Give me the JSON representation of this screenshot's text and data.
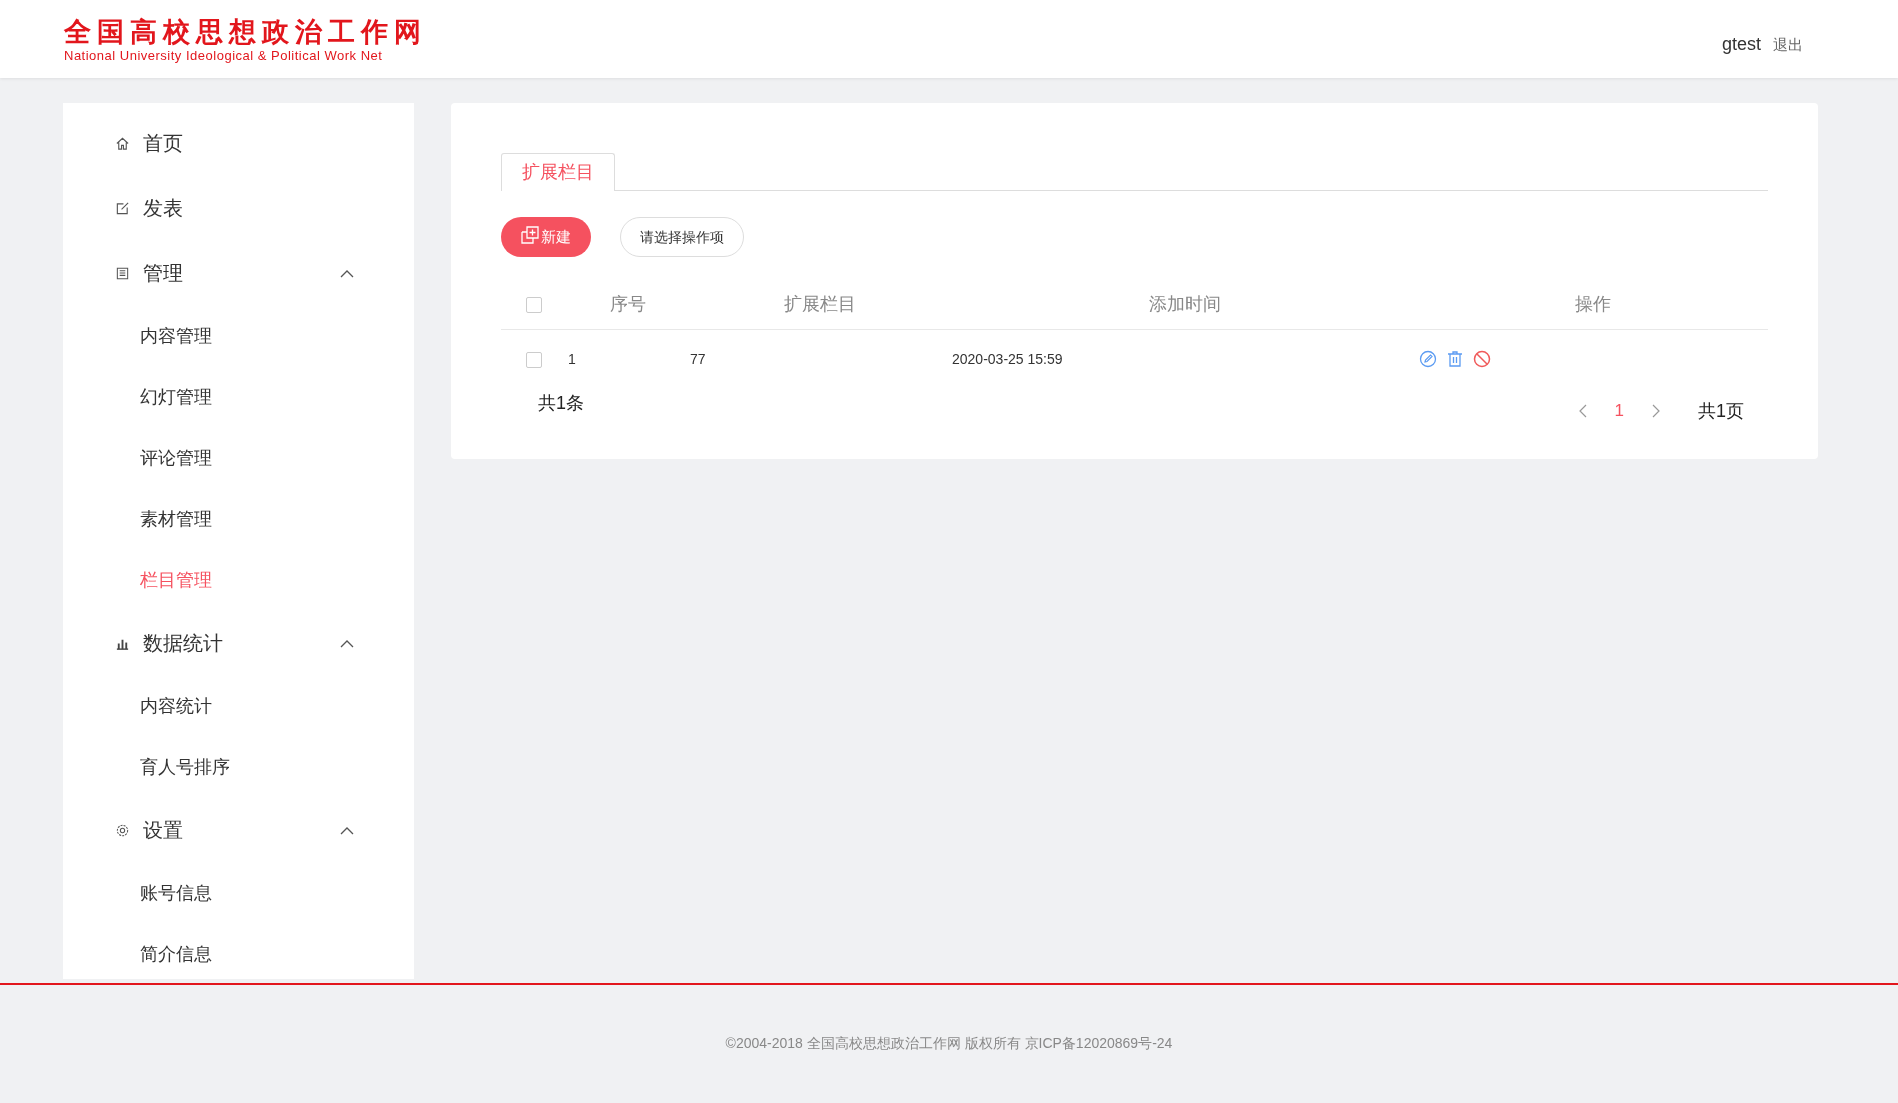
{
  "header": {
    "logo_title": "全国高校思想政治工作网",
    "logo_subtitle": "National University Ideological & Political Work Net",
    "user": "gtest",
    "logout": "退出"
  },
  "sidebar": {
    "items": [
      {
        "label": "首页",
        "selected": false
      },
      {
        "label": "发表",
        "selected": false
      },
      {
        "label": "管理",
        "selected": false,
        "expanded": true,
        "children": [
          {
            "label": "内容管理",
            "selected": false
          },
          {
            "label": "幻灯管理",
            "selected": false
          },
          {
            "label": "评论管理",
            "selected": false
          },
          {
            "label": "素材管理",
            "selected": false
          },
          {
            "label": "栏目管理",
            "selected": true
          }
        ]
      },
      {
        "label": "数据统计",
        "selected": false,
        "expanded": true,
        "children": [
          {
            "label": "内容统计",
            "selected": false
          },
          {
            "label": "育人号排序",
            "selected": false
          }
        ]
      },
      {
        "label": "设置",
        "selected": false,
        "expanded": true,
        "children": [
          {
            "label": "账号信息",
            "selected": false
          },
          {
            "label": "简介信息",
            "selected": false
          }
        ]
      }
    ]
  },
  "tabs": [
    {
      "label": "扩展栏目",
      "selected": true
    }
  ],
  "toolbar": {
    "new_button": "新建",
    "action_select": {
      "placeholder": "请选择操作项"
    }
  },
  "table": {
    "select_all": {
      "checked": false
    },
    "columns": [
      "序号",
      "扩展栏目",
      "添加时间",
      "操作"
    ],
    "rows": [
      {
        "checked": false,
        "cells": [
          "1",
          "77",
          "2020-03-25 15:59"
        ]
      }
    ]
  },
  "pagination": {
    "total": "共1条",
    "pages": [
      {
        "label": "1",
        "selected": true
      }
    ],
    "page_count": "共1页"
  },
  "footer": {
    "text": "©2004-2018 全国高校思想政治工作网 版权所有 京ICP备12020869号-24"
  }
}
